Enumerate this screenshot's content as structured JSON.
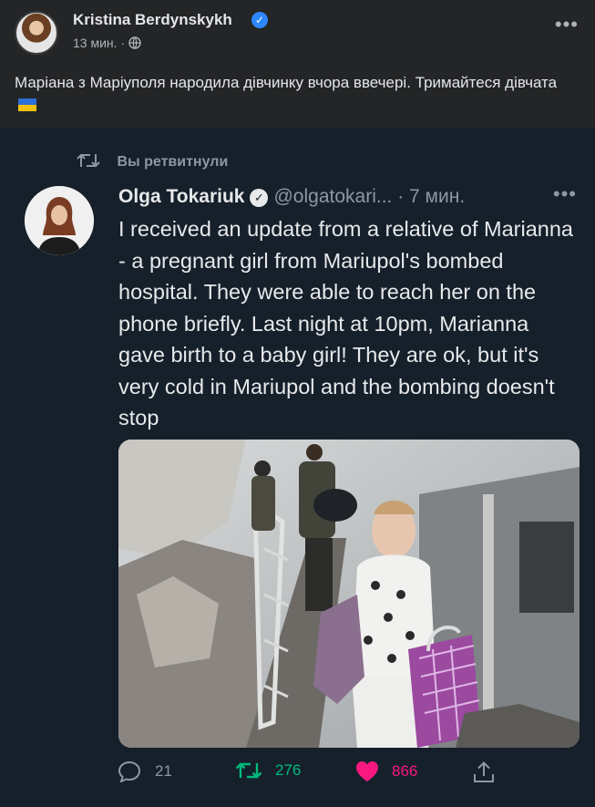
{
  "facebook_post": {
    "author": "Kristina Berdynskykh",
    "time": "13 мин.",
    "separator": "·",
    "text": "Маріана з Маріуполя народила дівчинку вчора ввечері. Тримайтеся дівчата",
    "flag_colors": [
      "#2d6fd8",
      "#f4c20d"
    ]
  },
  "tweet": {
    "retweet_label": "Вы ретвитнули",
    "author_name": "Olga Tokariuk",
    "handle": "@olgatokari...",
    "time": "· 7 мин.",
    "text": "I received an update from a relative of Marianna - a pregnant girl from Mariupol's bombed hospital. They were able to reach her on the phone briefly. Last night at 10pm, Marianna gave birth to a baby girl! They are ok, but it's very cold in Mariupol and the bombing doesn't stop",
    "stats": {
      "replies": "21",
      "retweets": "276",
      "likes": "866"
    },
    "colors": {
      "retweet": "#00ba7c",
      "like": "#f91880",
      "muted": "#8b98a5"
    }
  }
}
